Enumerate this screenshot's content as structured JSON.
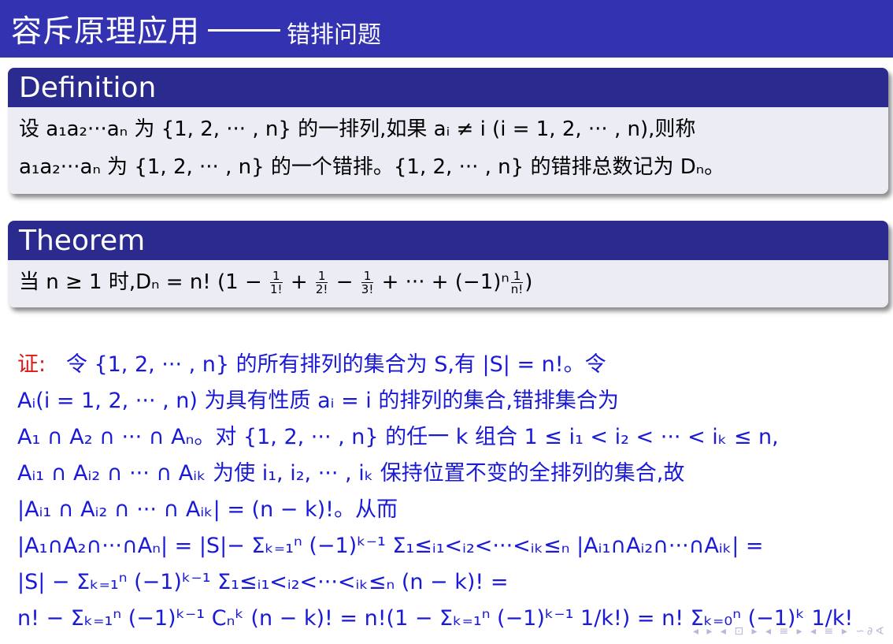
{
  "header": {
    "title": "容斥原理应用",
    "subtitle": "错排问题"
  },
  "definition": {
    "title": "Definition",
    "line1": "设 a₁a₂···aₙ 为 {1, 2, ··· , n} 的一排列,如果 aᵢ ≠ i (i = 1, 2, ··· , n),则称",
    "line2": "a₁a₂···aₙ 为 {1, 2, ··· , n} 的一个错排。{1, 2, ··· , n} 的错排总数记为 Dₙ。"
  },
  "theorem": {
    "title": "Theorem",
    "prefix": "当 n ≥ 1 时,Dₙ = n! (1 − ",
    "f1n": "1",
    "f1d": "1!",
    "f2n": "1",
    "f2d": "2!",
    "f3n": "1",
    "f3d": "3!",
    "mid": " + ··· + (−1)ⁿ",
    "f4n": "1",
    "f4d": "n!",
    "suffix": ")"
  },
  "proof": {
    "label": "证:",
    "line1": "令 {1, 2, ··· , n} 的所有排列的集合为 S,有 |S| = n!。令",
    "line2": "Aᵢ(i = 1, 2, ··· , n) 为具有性质 aᵢ = i 的排列的集合,错排集合为",
    "line3": "A₁ ∩ A₂ ∩ ··· ∩ Aₙ。对 {1, 2, ··· , n} 的任一 k 组合 1 ≤ i₁ < i₂ < ··· < iₖ ≤ n,",
    "line4": "Aᵢ₁ ∩ Aᵢ₂ ∩ ··· ∩ Aᵢₖ 为使 i₁, i₂, ··· , iₖ 保持位置不变的全排列的集合,故",
    "line5": "|Aᵢ₁ ∩ Aᵢ₂ ∩ ··· ∩ Aᵢₖ| = (n − k)!。从而",
    "line6": "|A₁∩A₂∩···∩Aₙ| = |S|− Σₖ₌₁ⁿ (−1)ᵏ⁻¹ Σ₁≤ᵢ₁<ᵢ₂<···<ᵢₖ≤ₙ |Aᵢ₁∩Aᵢ₂∩···∩Aᵢₖ| =",
    "line7": "|S| − Σₖ₌₁ⁿ (−1)ᵏ⁻¹ Σ₁≤ᵢ₁<ᵢ₂<···<ᵢₖ≤ₙ (n − k)! =",
    "line8": "n! − Σₖ₌₁ⁿ (−1)ᵏ⁻¹ Cₙᵏ (n − k)! = n!(1 − Σₖ₌₁ⁿ (−1)ᵏ⁻¹ 1/k!) = n! Σₖ₌₀ⁿ (−1)ᵏ 1/k!"
  },
  "nav": {
    "symbols": "◂ ▸ ◂ ⊡ ▸ ◂ ≡ ▸ ◂ ≡ ▸ ∽∂∢"
  }
}
